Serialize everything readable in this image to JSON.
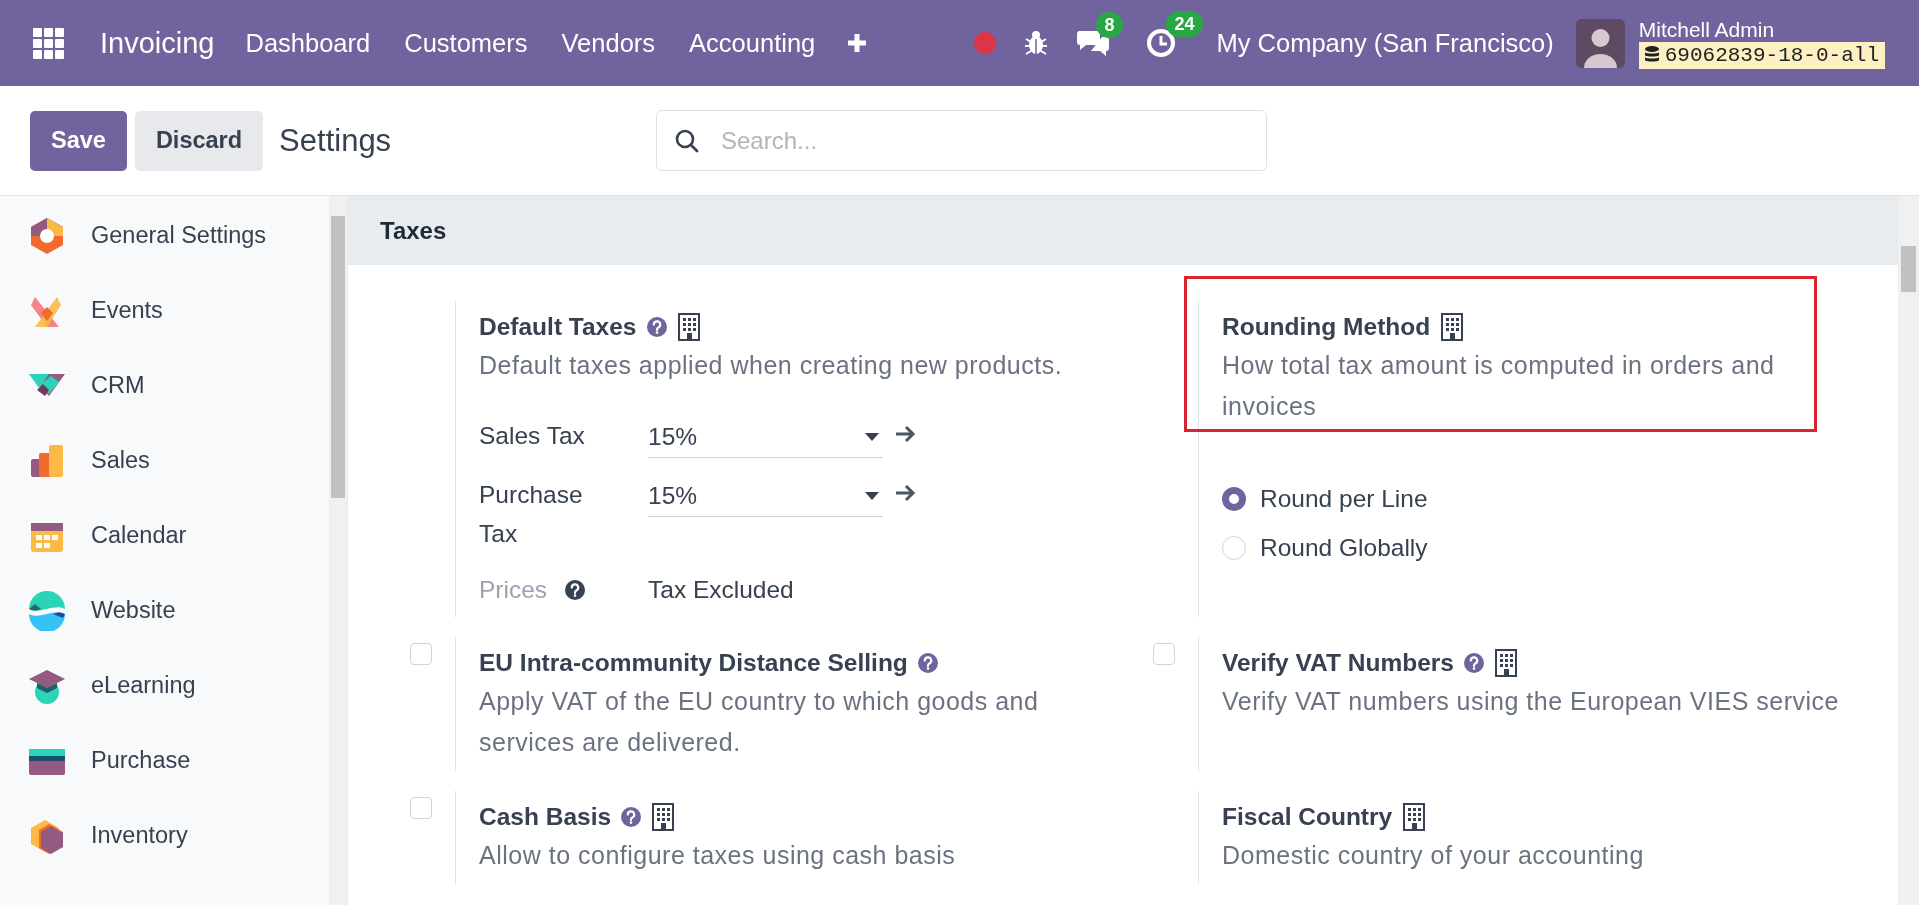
{
  "navbar": {
    "app_name": "Invoicing",
    "menu": [
      "Dashboard",
      "Customers",
      "Vendors",
      "Accounting"
    ],
    "messages_count": "8",
    "activities_count": "24",
    "company": "My Company (San Francisco)",
    "user": "Mitchell Admin",
    "database": "69062839-18-0-all"
  },
  "control_panel": {
    "buttons": [
      {
        "label": "Save",
        "kind": "primary"
      },
      {
        "label": "Discard",
        "kind": "secondary"
      }
    ],
    "title": "Settings",
    "search": {
      "placeholder": "Search..."
    }
  },
  "sidebar": {
    "items": [
      {
        "label": "General Settings"
      },
      {
        "label": "Events"
      },
      {
        "label": "CRM"
      },
      {
        "label": "Sales"
      },
      {
        "label": "Calendar"
      },
      {
        "label": "Website"
      },
      {
        "label": "eLearning"
      },
      {
        "label": "Purchase"
      },
      {
        "label": "Inventory"
      }
    ]
  },
  "section": {
    "title": "Taxes",
    "settings": [
      {
        "kind": "fields",
        "title": "Default Taxes",
        "help": true,
        "company_specific": true,
        "description": "Default taxes applied when creating new products.",
        "fields": [
          {
            "label": "Sales Tax",
            "value": "15%"
          },
          {
            "label": "Purchase Tax",
            "value": "15%"
          }
        ],
        "prices": {
          "label": "Prices",
          "value": "Tax Excluded"
        }
      },
      {
        "kind": "radio",
        "title": "Rounding Method",
        "help": false,
        "company_specific": true,
        "highlighted": true,
        "description": "How total tax amount is computed in orders and invoices",
        "options": [
          {
            "label": "Round per Line",
            "selected": true
          },
          {
            "label": "Round Globally",
            "selected": false
          }
        ]
      },
      {
        "kind": "checkbox",
        "checked": false,
        "title": "EU Intra-community Distance Selling",
        "help": true,
        "company_specific": false,
        "description": "Apply VAT of the EU country to which goods and services are delivered."
      },
      {
        "kind": "checkbox",
        "checked": false,
        "title": "Verify VAT Numbers",
        "help": true,
        "company_specific": true,
        "description": "Verify VAT numbers using the European VIES service"
      },
      {
        "kind": "checkbox",
        "checked": false,
        "title": "Cash Basis",
        "help": true,
        "company_specific": true,
        "description": "Allow to configure taxes using cash basis"
      },
      {
        "kind": "plain",
        "title": "Fiscal Country",
        "help": false,
        "company_specific": true,
        "description": "Domestic country of your accounting"
      }
    ]
  }
}
